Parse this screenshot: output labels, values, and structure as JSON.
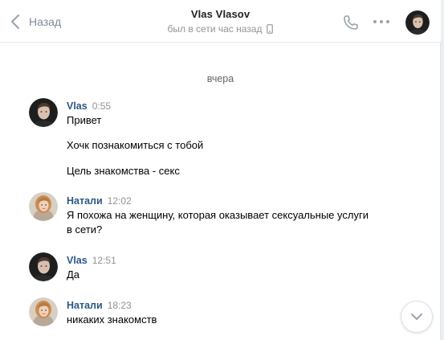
{
  "header": {
    "back_label": "Назад",
    "title": "Vlas Vlasov",
    "status": "был в сети час назад"
  },
  "date_divider": "вчера",
  "messages": [
    {
      "author": "Vlas",
      "time": "0:55",
      "lines": [
        "Привет",
        "Хочк познакомиться с тобой",
        "Цель знакомства - секс"
      ]
    },
    {
      "author": "Натали",
      "time": "12:02",
      "lines": [
        "Я похожа на женщину, которая оказывает сексуальные услуги",
        "в сети?"
      ]
    },
    {
      "author": "Vlas",
      "time": "12:51",
      "lines": [
        "Да"
      ]
    },
    {
      "author": "Натали",
      "time": "18:23",
      "lines": [
        "никаких знакомств"
      ]
    }
  ],
  "icons": {
    "back": "chevron-left-icon",
    "mobile": "mobile-phone-icon",
    "call": "phone-icon",
    "more": "more-dots-icon",
    "scroll_down": "chevron-down-icon"
  },
  "colors": {
    "author_link": "#2a5885",
    "muted": "#939393",
    "back": "#828a99",
    "icon": "#99a2ad"
  }
}
